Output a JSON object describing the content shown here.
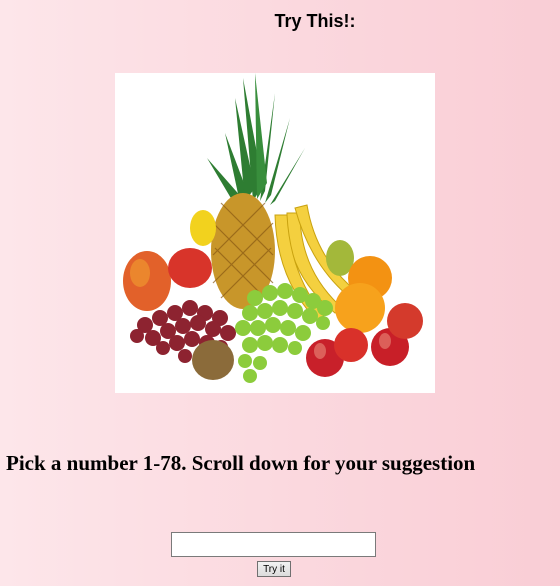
{
  "page": {
    "title": "Try This!:",
    "prompt": "Pick a number 1-78. Scroll down for your suggestion"
  },
  "image": {
    "subject": "fruit-arrangement"
  },
  "form": {
    "input_value": "",
    "button_label": "Try it"
  }
}
